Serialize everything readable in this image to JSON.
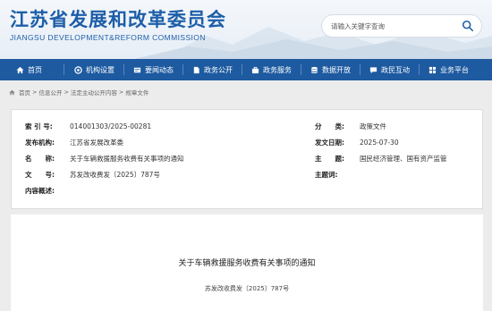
{
  "site": {
    "title": "江苏省发展和改革委员会",
    "subtitle": "JIANGSU DEVELOPMENT&REFORM COMMISSION"
  },
  "search": {
    "placeholder": "请输入关键字查询",
    "icon": "search-icon"
  },
  "nav": {
    "items": [
      {
        "label": "首页",
        "icon": "home-icon"
      },
      {
        "label": "机构设置",
        "icon": "org-icon"
      },
      {
        "label": "要闻动态",
        "icon": "news-icon"
      },
      {
        "label": "政务公开",
        "icon": "document-icon"
      },
      {
        "label": "政务服务",
        "icon": "service-icon"
      },
      {
        "label": "数据开放",
        "icon": "database-icon"
      },
      {
        "label": "政民互动",
        "icon": "interaction-icon"
      },
      {
        "label": "业务平台",
        "icon": "platform-icon"
      }
    ]
  },
  "breadcrumb": {
    "items": [
      "首页",
      "信息公开",
      "法定主动公开内容",
      "规章文件"
    ]
  },
  "info": {
    "index_label": "索 引 号:",
    "index_value": "014001303/2025-00281",
    "category_label": "分　　类:",
    "category_value": "政策文件",
    "issuer_label": "发布机构:",
    "issuer_value": "江苏省发展改革委",
    "date_label": "发文日期:",
    "date_value": "2025-07-30",
    "name_label": "名　　称:",
    "name_value": "关于车辆救援服务收费有关事项的通知",
    "topic_label": "主　　题:",
    "topic_value": "国民经济管理、国有资产监管",
    "docno_label": "文　　号:",
    "docno_value": "苏发改收费发〔2025〕787号",
    "keywords_label": "主题词:",
    "keywords_value": "",
    "summary_label": "内容概述:",
    "summary_value": ""
  },
  "article": {
    "title": "关于车辆救援服务收费有关事项的通知",
    "doc_number": "苏发改收费发〔2025〕787号"
  },
  "colors": {
    "brand_blue": "#1d5ea8",
    "nav_bg": "#1d5aa0"
  }
}
